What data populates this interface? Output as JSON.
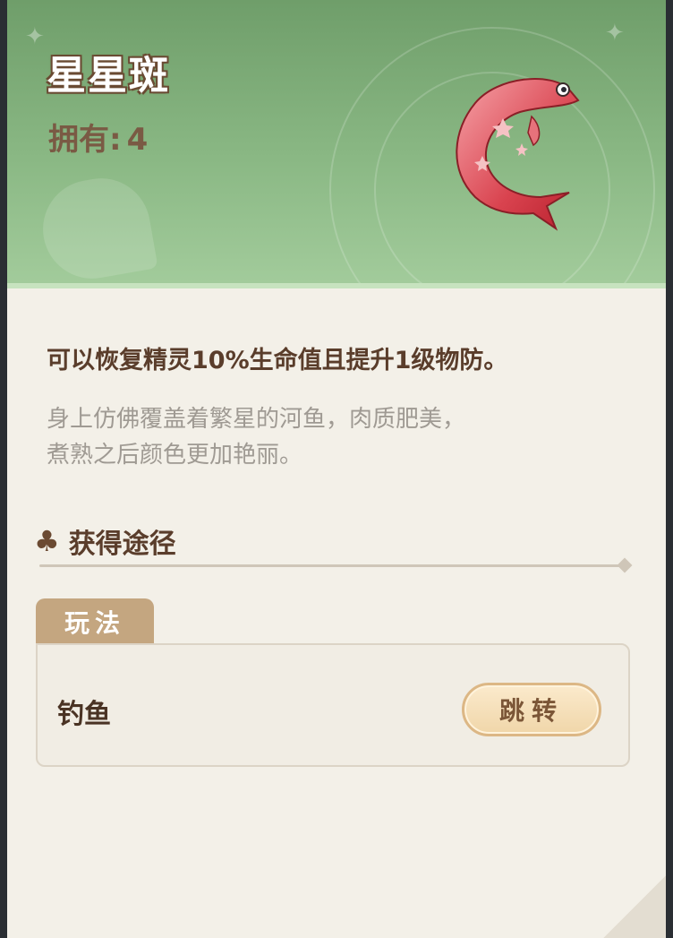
{
  "item": {
    "name": "星星斑",
    "owned_label": "拥有:",
    "owned_count": "4",
    "image_icon": "fish-icon"
  },
  "description": {
    "effect": "可以恢复精灵10%生命值且提升1级物防。",
    "flavor_line1": "身上仿佛覆盖着繁星的河鱼，肉质肥美，",
    "flavor_line2": "煮熟之后颜色更加艳丽。"
  },
  "acquire": {
    "section_title": "获得途径",
    "section_icon": "clover-icon",
    "tab_label": "玩法",
    "method": "钓鱼",
    "jump_label": "跳转"
  },
  "colors": {
    "header_green": "#8ab884",
    "paper": "#f3f0e8",
    "title_outline": "#6a4b33",
    "tab_tan": "#c4a680",
    "button_fill": "#f0d6a9"
  }
}
